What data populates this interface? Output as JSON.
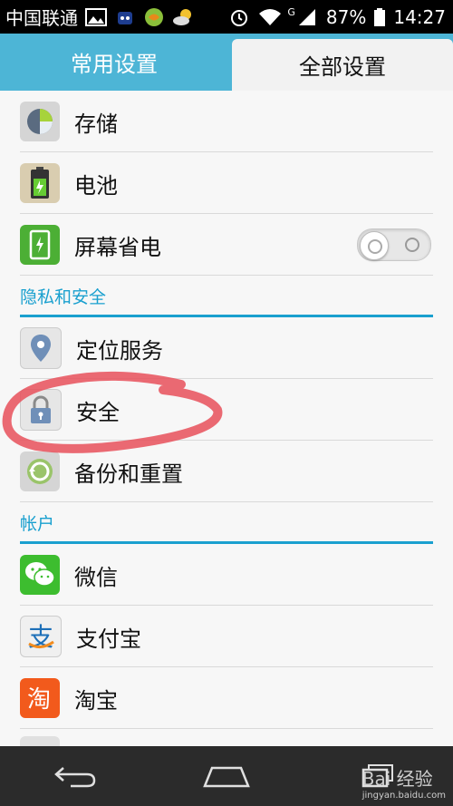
{
  "status_bar": {
    "carrier": "中国联通",
    "battery": "87%",
    "network": "G",
    "time": "14:27"
  },
  "tabs": [
    {
      "label": "常用设置",
      "active": true
    },
    {
      "label": "全部设置",
      "active": false
    }
  ],
  "rows_top": [
    {
      "label": "存储",
      "icon": "storage-icon"
    },
    {
      "label": "电池",
      "icon": "battery-icon"
    },
    {
      "label": "屏幕省电",
      "icon": "screen-power-icon",
      "toggle": false
    }
  ],
  "section_privacy": "隐私和安全",
  "rows_privacy": [
    {
      "label": "定位服务",
      "icon": "location-icon"
    },
    {
      "label": "安全",
      "icon": "lock-icon"
    },
    {
      "label": "备份和重置",
      "icon": "backup-icon"
    }
  ],
  "section_accounts": "帐户",
  "rows_accounts": [
    {
      "label": "微信",
      "icon": "wechat-icon"
    },
    {
      "label": "支付宝",
      "icon": "alipay-icon"
    },
    {
      "label": "淘宝",
      "icon": "taobao-icon"
    }
  ],
  "watermark": {
    "brand": "Bai 经验",
    "url": "jingyan.baidu.com"
  },
  "colors": {
    "tab_bg": "#4db5d6",
    "section_accent": "#1aa0cf",
    "annotation": "#e8505b"
  }
}
